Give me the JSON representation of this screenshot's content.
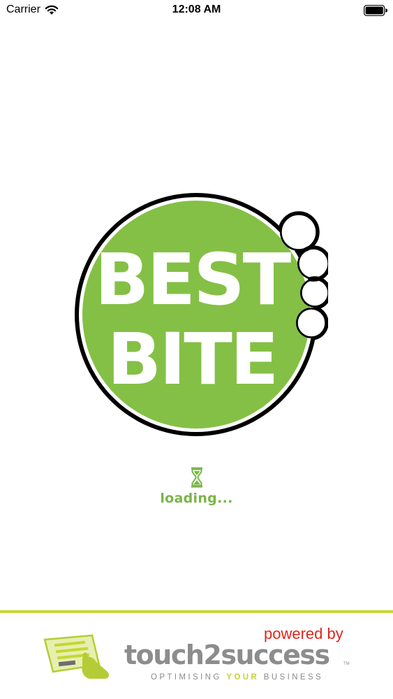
{
  "status_bar": {
    "carrier": "Carrier",
    "time": "12:08 AM",
    "wifi_icon": "wifi-icon",
    "battery_icon": "battery-icon"
  },
  "logo": {
    "line1": "BEST",
    "line2": "BITE",
    "fill_color": "#84c045",
    "outline_color": "#000000",
    "text_color": "#ffffff"
  },
  "loading": {
    "icon": "hourglass-icon",
    "text": "loading...",
    "color": "#7ab648"
  },
  "footer": {
    "powered_by": "powered by",
    "brand": "touch2success",
    "trademark": "TM",
    "tagline_before": "OPTIMISING ",
    "tagline_highlight": "YOUR",
    "tagline_after": " BUSINESS",
    "accent_color": "#c4d832",
    "powered_color": "#e0261c",
    "brand_color": "#8c8c8c"
  }
}
